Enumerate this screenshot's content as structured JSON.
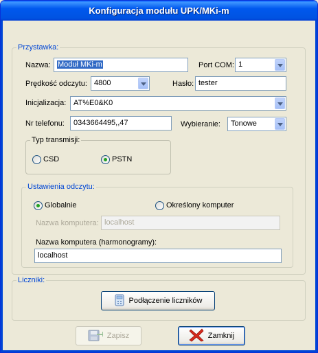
{
  "window": {
    "title": "Konfiguracja modułu UPK/MKi-m"
  },
  "przystawka": {
    "legend": "Przystawka:",
    "nazwa_label": "Nazwa:",
    "nazwa_value": "Moduł MKi-m",
    "port_label": "Port COM:",
    "port_value": "1",
    "predkosc_label": "Prędkość odczytu:",
    "predkosc_value": "4800",
    "haslo_label": "Hasło:",
    "haslo_value": "tester",
    "init_label": "Inicjalizacja:",
    "init_value": "AT%E0&K0",
    "tel_label": "Nr telefonu:",
    "tel_value": "0343664495,,47",
    "wybieranie_label": "Wybieranie:",
    "wybieranie_value": "Tonowe",
    "typ": {
      "legend": "Typ transmisji:",
      "csd_label": "CSD",
      "pstn_label": "PSTN",
      "selected": "PSTN"
    }
  },
  "ustawienia": {
    "legend": "Ustawienia odczytu:",
    "globalnie_label": "Globalnie",
    "okreslony_label": "Określony komputer",
    "selected": "Globalnie",
    "nazwa_komp_label": "Nazwa komputera:",
    "nazwa_komp_value": "localhost",
    "nazwa_harm_label": "Nazwa komputera (harmonogramy):",
    "nazwa_harm_value": "localhost"
  },
  "liczniki": {
    "legend": "Liczniki:",
    "button_label": "Podłączenie liczników"
  },
  "footer": {
    "zapisz_label": "Zapisz",
    "zamknij_label": "Zamknij"
  }
}
